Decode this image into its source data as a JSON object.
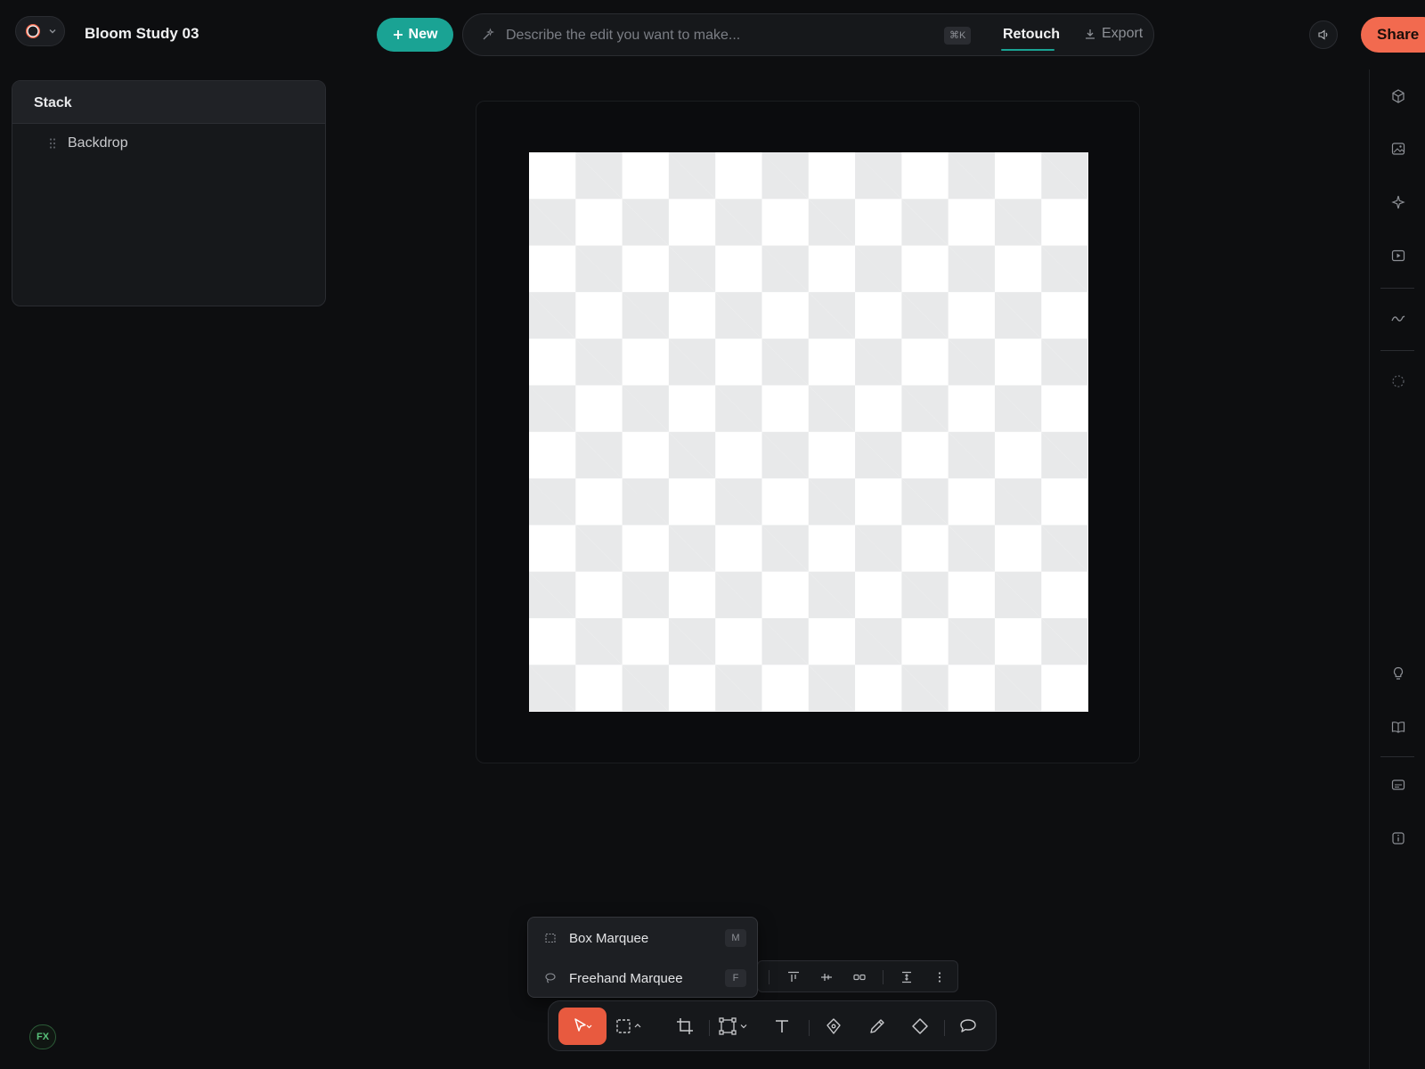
{
  "header": {
    "document_title": "Bloom Study 03",
    "new_label": "New",
    "prompt_placeholder": "Describe the edit you want to make...",
    "prompt_shortcut": "⌘K",
    "tab_retouch": "Retouch",
    "tab_export": "Export",
    "share_label": "Share"
  },
  "layers": {
    "title": "Stack",
    "items": [
      {
        "label": "Backdrop"
      }
    ]
  },
  "marquee_menu": {
    "items": [
      {
        "label": "Box Marquee",
        "shortcut": "M"
      },
      {
        "label": "Freehand Marquee",
        "shortcut": "F"
      }
    ]
  },
  "footer": {
    "fx_label": "FX"
  },
  "colors": {
    "accent_teal": "#1aa394",
    "accent_coral": "#f26a4f",
    "active_tool": "#e85a3f",
    "background": "#0d0e10"
  },
  "icons": {
    "rail": [
      "cube-icon",
      "image-icon",
      "sparkle-icon",
      "video-icon",
      "wave-icon",
      "dotted-circle-icon",
      "lightbulb-icon",
      "book-icon",
      "caption-icon",
      "info-icon"
    ],
    "toolbar": [
      "pointer-icon",
      "marquee-icon",
      "crop-icon",
      "transform-icon",
      "text-icon",
      "pen-icon",
      "pencil-icon",
      "diamond-icon",
      "comment-icon"
    ]
  }
}
